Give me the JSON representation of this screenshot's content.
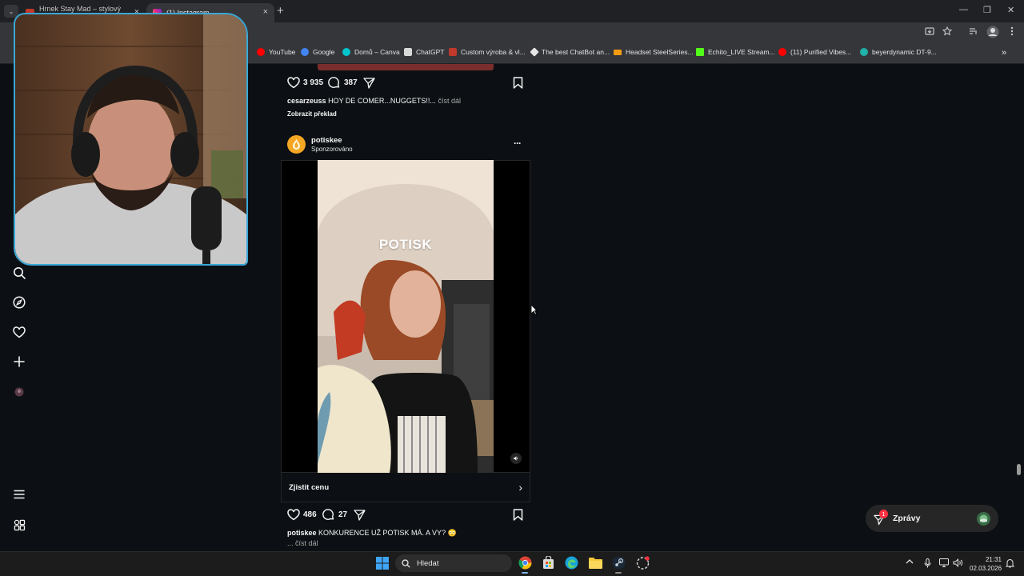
{
  "browser": {
    "tabs": [
      {
        "title": "Hrnek Stay Mad – stylový kera...",
        "favicon_color": "#c0392b"
      },
      {
        "title": "(1) Instagram",
        "favicon_color": "#e1306c"
      }
    ],
    "new_tab": "+",
    "tab_close": "×",
    "tab_search": "⌄",
    "window": {
      "minimize": "—",
      "maximize": "❐",
      "close": "✕"
    },
    "bookmarks": [
      {
        "label": "YouTube",
        "color": "#ff0000"
      },
      {
        "label": "Google",
        "color": "#4285f4"
      },
      {
        "label": "Domů – Canva",
        "color": "#00c4cc"
      },
      {
        "label": "ChatGPT",
        "color": "#d9d9d9"
      },
      {
        "label": "Custom výroba & vl...",
        "color": "#c0392b"
      },
      {
        "label": "The best ChatBot an...",
        "color": "#e6e6e6"
      },
      {
        "label": "Headset SteelSeries...",
        "color": "#f39c12"
      },
      {
        "label": "Echito_LIVE Stream...",
        "color": "#53fc18"
      },
      {
        "label": "(11) Purified Vibes...",
        "color": "#ff0000"
      },
      {
        "label": "beyerdynamic DT-9...",
        "color": "#20b2aa"
      }
    ],
    "bookmarks_more": "»"
  },
  "post_prev": {
    "likes": "3 935",
    "comments": "387",
    "caption_user": "cesarzeuss",
    "caption_text": "HOY DE COMER...NUGGETS!!...",
    "more": "číst dál",
    "translate": "Zobrazit překlad"
  },
  "post": {
    "username": "potiskee",
    "sponsored": "Sponzorováno",
    "menu": "···",
    "video_text": "POTISK",
    "cta": "Zjistit cenu",
    "cta_arrow": "›",
    "likes": "486",
    "comments": "27",
    "caption_user": "potiskee",
    "caption_text": "KONKURENCE UŽ POTISK MÁ. A VY? 😳",
    "more": "... číst dál"
  },
  "messages": {
    "label": "Zprávy",
    "badge": "1"
  },
  "taskbar": {
    "search": "Hledat",
    "time": "21:31",
    "date": "02.03.2026"
  },
  "colors": {
    "background": "#0c1014",
    "webcam_border": "#3aa7d8",
    "badge": "#ff3040"
  }
}
